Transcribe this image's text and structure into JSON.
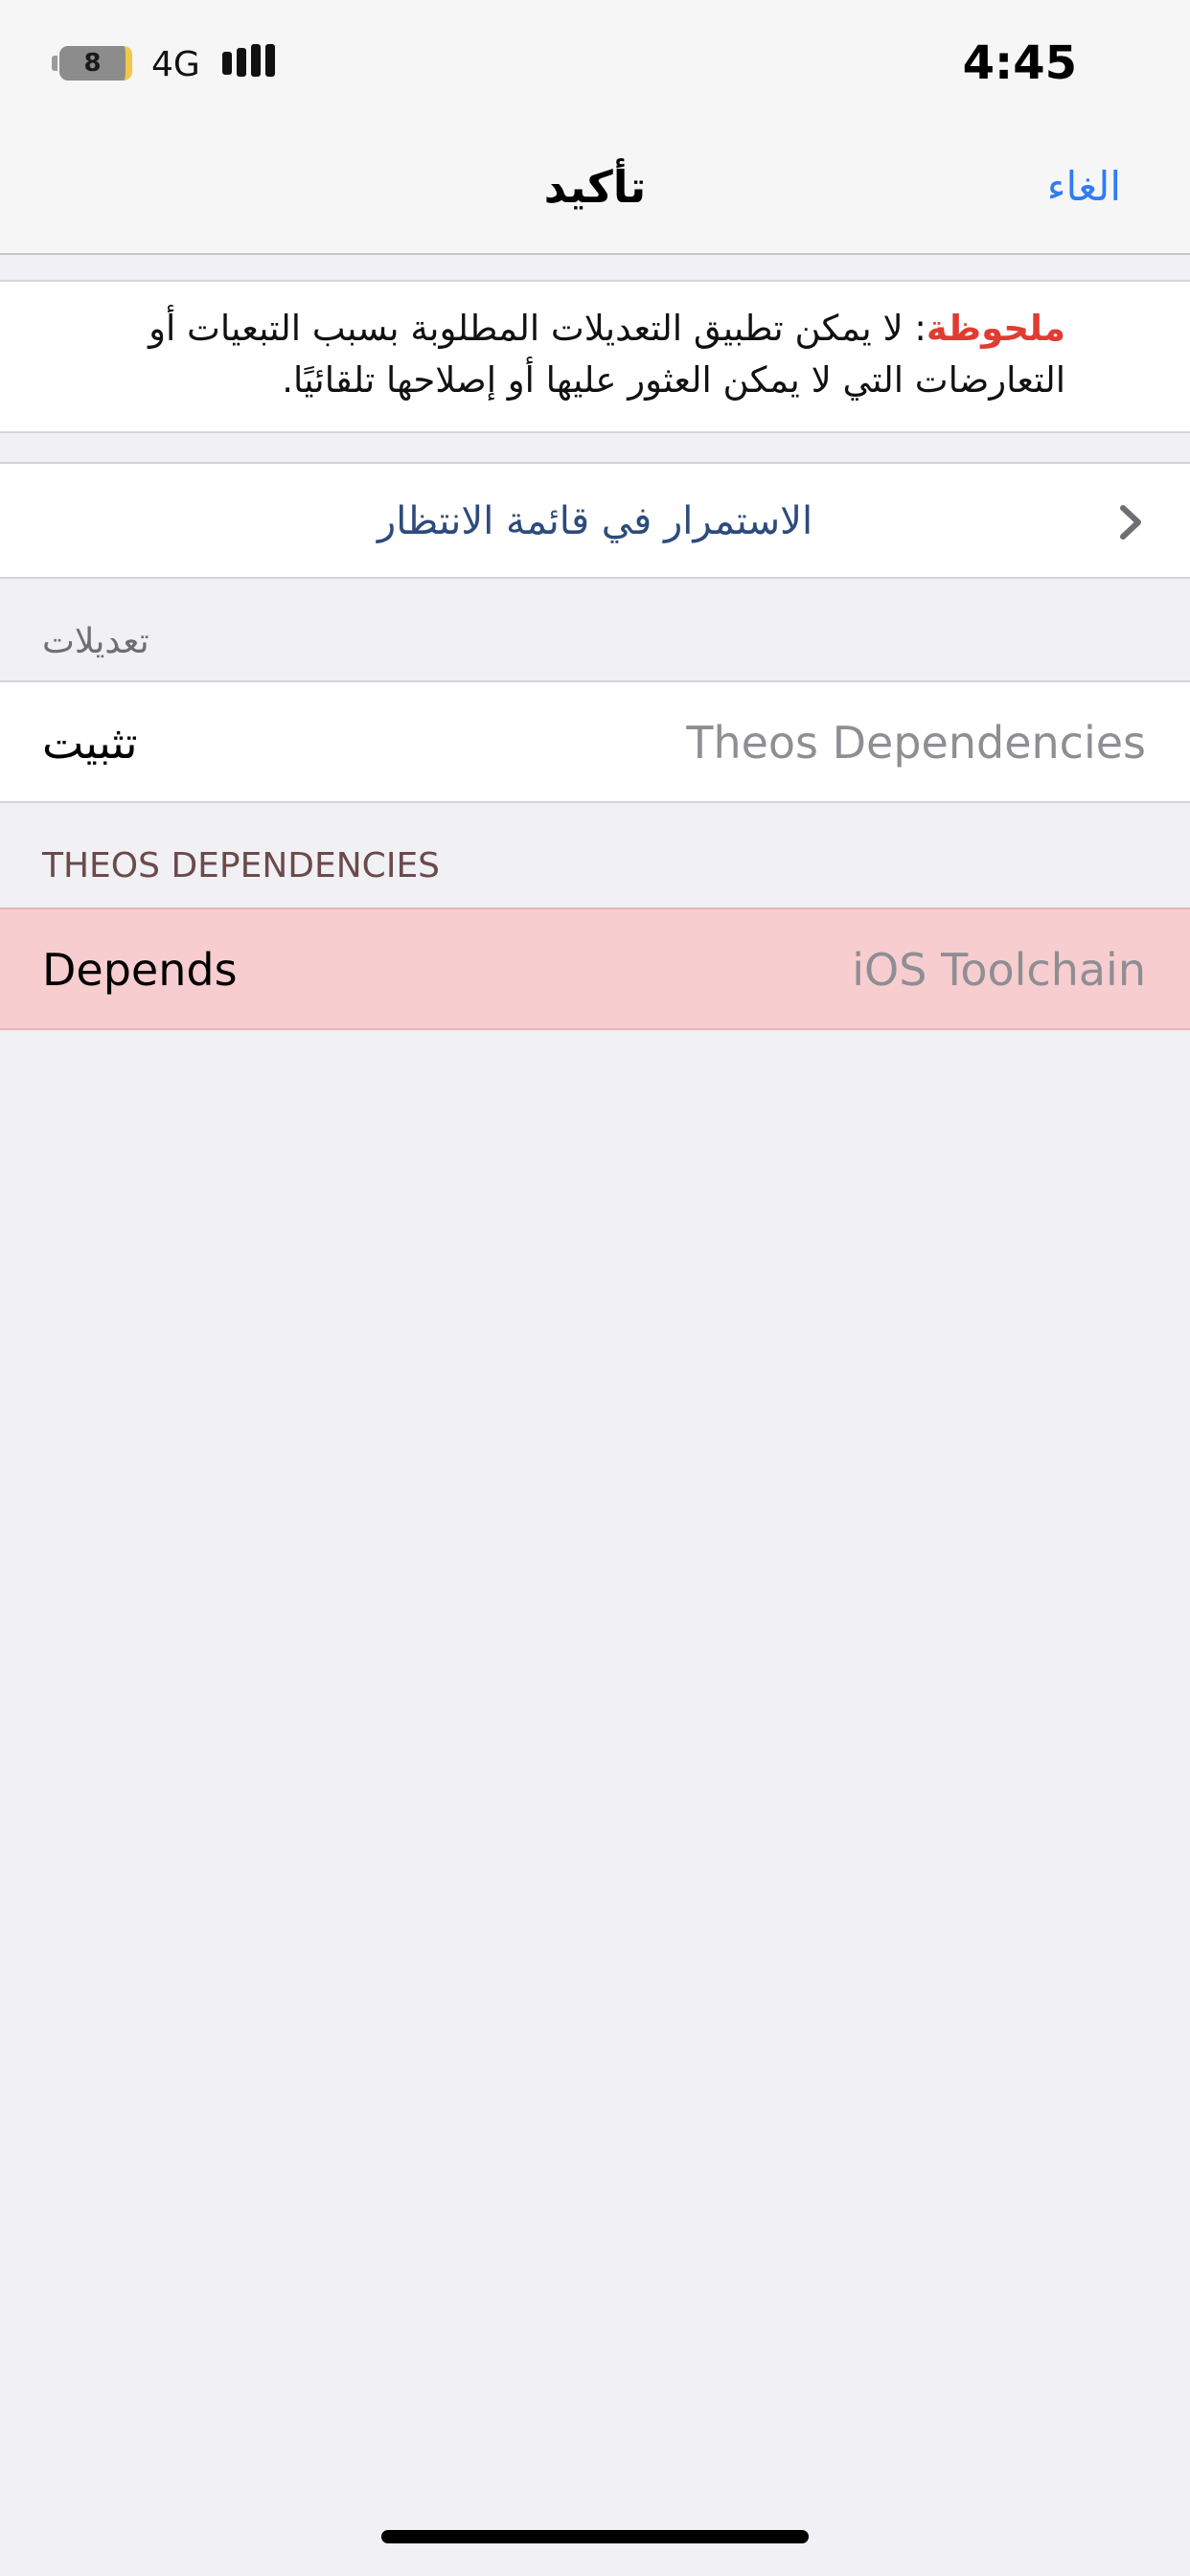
{
  "status_bar": {
    "battery_level": "8",
    "battery_charging": true,
    "network": "4G",
    "time": "4:45"
  },
  "nav": {
    "title": "تأكيد",
    "cancel_label": "الغاء"
  },
  "note": {
    "label": "ملحوظة",
    "text": ": لا يمكن تطبيق التعديلات المطلوبة بسبب التبعيات أو التعارضات التي لا يمكن العثور عليها أو إصلاحها تلقائيًا."
  },
  "queue": {
    "label": "الاستمرار في قائمة الانتظار",
    "icon": "chevron-icon"
  },
  "modifications": {
    "header": "تعديلات",
    "row": {
      "action": "تثبيت",
      "package": "Theos Dependencies"
    }
  },
  "theos": {
    "header": "THEOS DEPENDENCIES",
    "row": {
      "relation": "Depends",
      "package": "iOS Toolchain"
    }
  },
  "colors": {
    "accent_blue": "#2f7cf6",
    "note_red": "#e03c31",
    "error_row_bg": "#f7cdd0",
    "queue_text": "#2d4b7c"
  }
}
